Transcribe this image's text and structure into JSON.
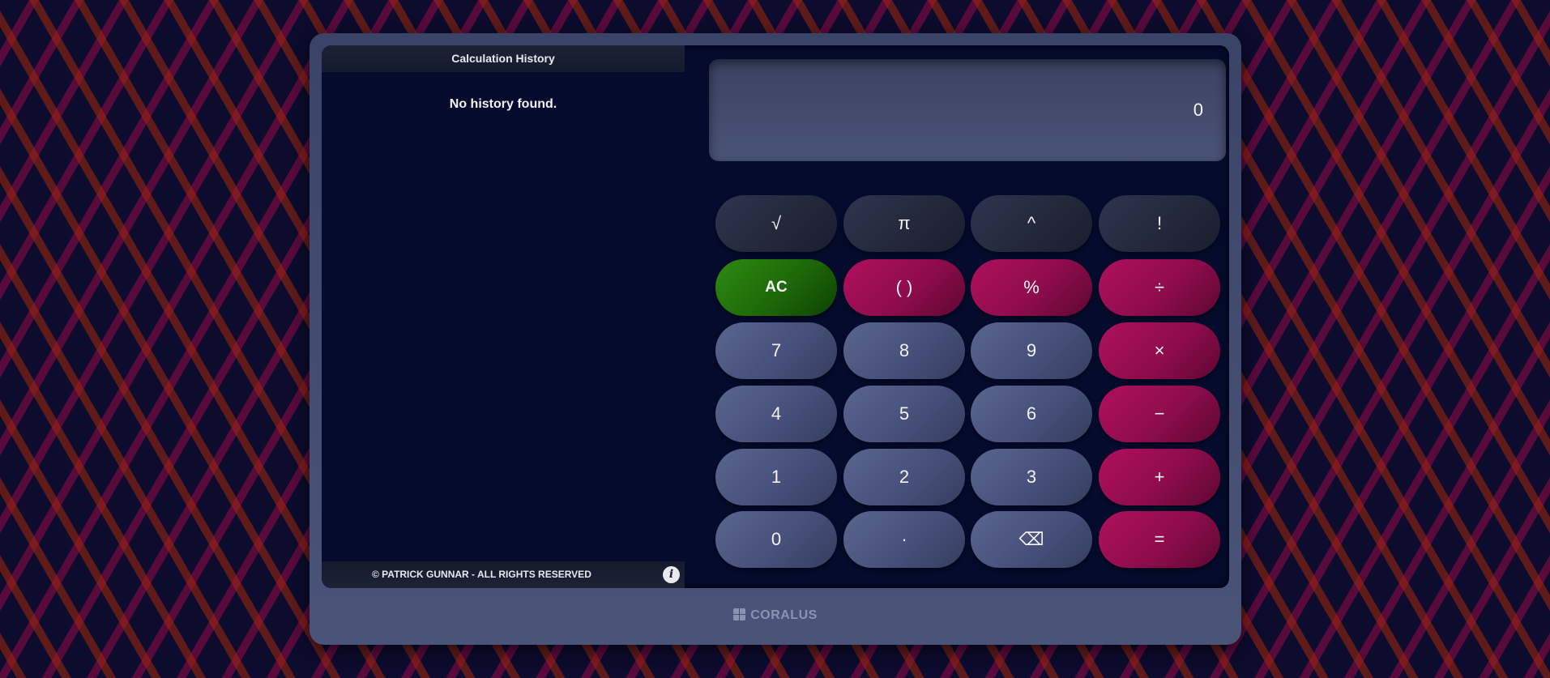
{
  "history": {
    "title": "Calculation History",
    "empty_message": "No history found.",
    "footer": "© PATRICK GUNNAR - ALL RIGHTS RESERVED",
    "info_icon": "i"
  },
  "display": {
    "value": "0"
  },
  "keys": {
    "sqrt": "√",
    "pi": "π",
    "power": "^",
    "factorial": "!",
    "clear": "AC",
    "parentheses": "( )",
    "percent": "%",
    "divide": "÷",
    "seven": "7",
    "eight": "8",
    "nine": "9",
    "multiply": "×",
    "four": "4",
    "five": "5",
    "six": "6",
    "subtract": "−",
    "one": "1",
    "two": "2",
    "three": "3",
    "add": "+",
    "zero": "0",
    "decimal": "·",
    "backspace": "⌫",
    "equals": "="
  },
  "brand": {
    "name": "CORALUS"
  },
  "colors": {
    "background": "#0d0b2e",
    "screen": "#040b2d",
    "operator": "#8e0c4c",
    "clear": "#1d6808",
    "number": "#46507a",
    "function": "#222739"
  }
}
